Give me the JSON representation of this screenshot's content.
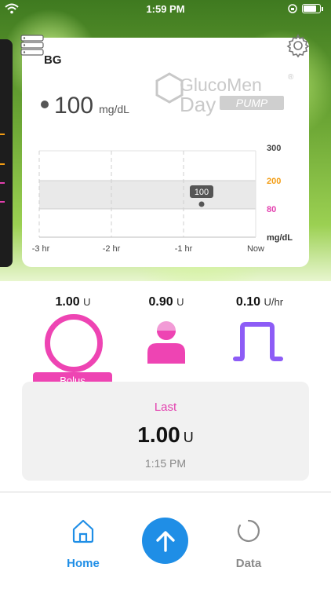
{
  "status": {
    "time": "1:59 PM"
  },
  "card": {
    "label": "BG",
    "brand_line1": "GlucoMen",
    "brand_line2": "Day",
    "brand_badge": "PUMP",
    "brand_registered": "®",
    "reading_value": "100",
    "reading_unit": "mg/dL"
  },
  "chart_data": {
    "type": "scatter",
    "x_tick_labels": [
      "-3 hr",
      "-2 hr",
      "-1 hr",
      "Now"
    ],
    "y_tick_labels": [
      "300",
      "200",
      "80"
    ],
    "y_tick_colors": [
      "#444444",
      "#f39c12",
      "#e33fae"
    ],
    "ylabel": "mg/dL",
    "ylim": [
      0,
      300
    ],
    "target_range": [
      80,
      200
    ],
    "points": [
      {
        "x": -0.75,
        "y": 100,
        "label": "100"
      }
    ],
    "grid": true
  },
  "summary": {
    "bolus_value": "1.00",
    "bolus_unit": "U",
    "basal_value": "0.90",
    "basal_unit": "U",
    "temp_value": "0.10",
    "temp_unit": "U/hr",
    "bolus_tag": "Bolus"
  },
  "last": {
    "title": "Last",
    "value": "1.00",
    "unit": "U",
    "time": "1:15 PM"
  },
  "nav": {
    "home_label": "Home",
    "data_label": "Data"
  },
  "colors": {
    "accent_pink": "#ee44b3",
    "accent_blue": "#1f8ee6",
    "accent_purple": "#8d5cf6",
    "nav_inactive": "#8a8a8a"
  }
}
